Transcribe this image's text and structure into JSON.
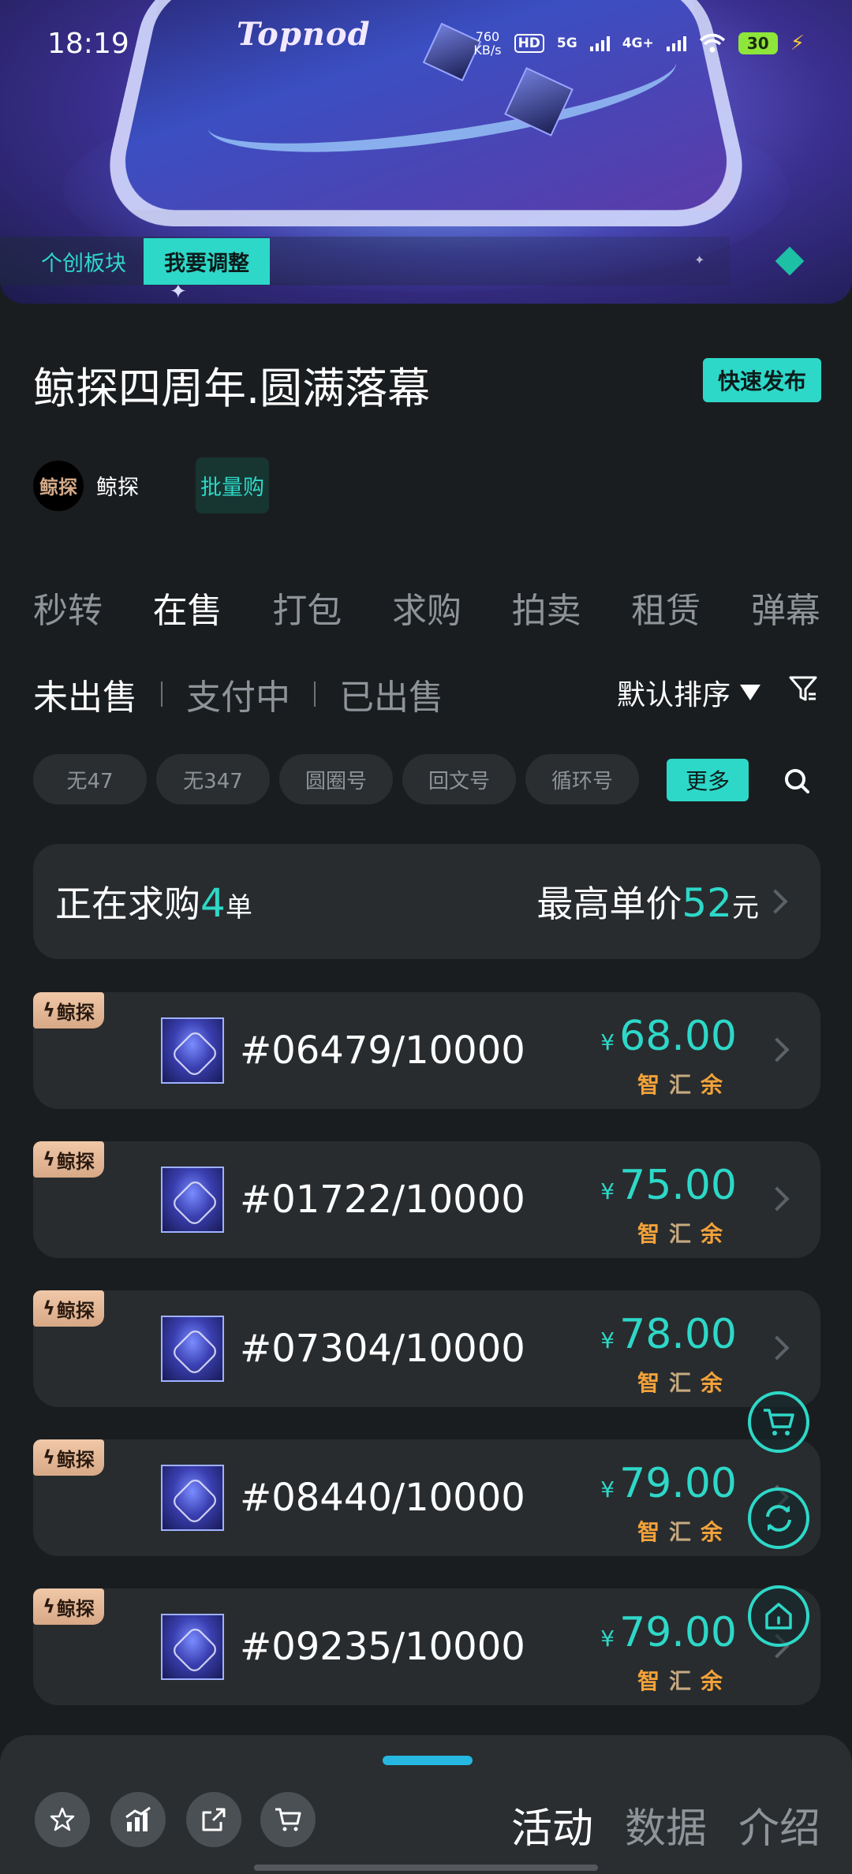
{
  "status_bar": {
    "time": "18:19",
    "net_speed_value": "760",
    "net_speed_unit": "KB/s",
    "hd_label": "HD",
    "sim1_label": "5G",
    "sim2_label": "4G+",
    "battery": "30"
  },
  "hero": {
    "brand_text": "Topnod",
    "tag_label": "个创板块",
    "tag_button": "我要调整"
  },
  "header": {
    "title": "鲸探四周年.圆满落幕",
    "quick_publish": "快速发布",
    "creator_avatar_text": "鲸探",
    "creator_name": "鲸探",
    "bulk_buy": "批量购"
  },
  "tabs": [
    "秒转",
    "在售",
    "打包",
    "求购",
    "拍卖",
    "租赁",
    "弹幕"
  ],
  "active_tab": "在售",
  "subtabs": [
    "未出售",
    "支付中",
    "已出售"
  ],
  "sort_label": "默认排序",
  "chips": [
    "无47",
    "无347",
    "圆圈号",
    "回文号",
    "循环号"
  ],
  "more_label": "更多",
  "summary": {
    "buying_prefix": "正在求购",
    "buying_count": "4",
    "buying_unit": "单",
    "max_prefix": "最高单价",
    "max_price": "52",
    "max_unit": "元"
  },
  "listings": [
    {
      "badge": "鲸探",
      "number": "#06479/10000",
      "currency": "¥",
      "price": "68.00",
      "tags": [
        "智",
        "汇",
        "余"
      ]
    },
    {
      "badge": "鲸探",
      "number": "#01722/10000",
      "currency": "¥",
      "price": "75.00",
      "tags": [
        "智",
        "汇",
        "余"
      ]
    },
    {
      "badge": "鲸探",
      "number": "#07304/10000",
      "currency": "¥",
      "price": "78.00",
      "tags": [
        "智",
        "汇",
        "余"
      ]
    },
    {
      "badge": "鲸探",
      "number": "#08440/10000",
      "currency": "¥",
      "price": "79.00",
      "tags": [
        "智",
        "汇",
        "余"
      ]
    },
    {
      "badge": "鲸探",
      "number": "#09235/10000",
      "currency": "¥",
      "price": "79.00",
      "tags": [
        "智",
        "汇",
        "余"
      ]
    }
  ],
  "bottom_sheet": {
    "tabs": [
      "活动",
      "数据",
      "介绍"
    ],
    "active_tab": "活动",
    "actions": [
      "star-icon",
      "trend-icon",
      "share-icon",
      "cart-icon"
    ]
  },
  "colors": {
    "accent": "#2ed8c8",
    "background": "#1a1d1f",
    "card": "#282c2f",
    "tag_orange": "#f3a23a",
    "badge": "#d7a886"
  },
  "fabs": [
    "cart-icon",
    "refresh-icon",
    "home-icon"
  ]
}
